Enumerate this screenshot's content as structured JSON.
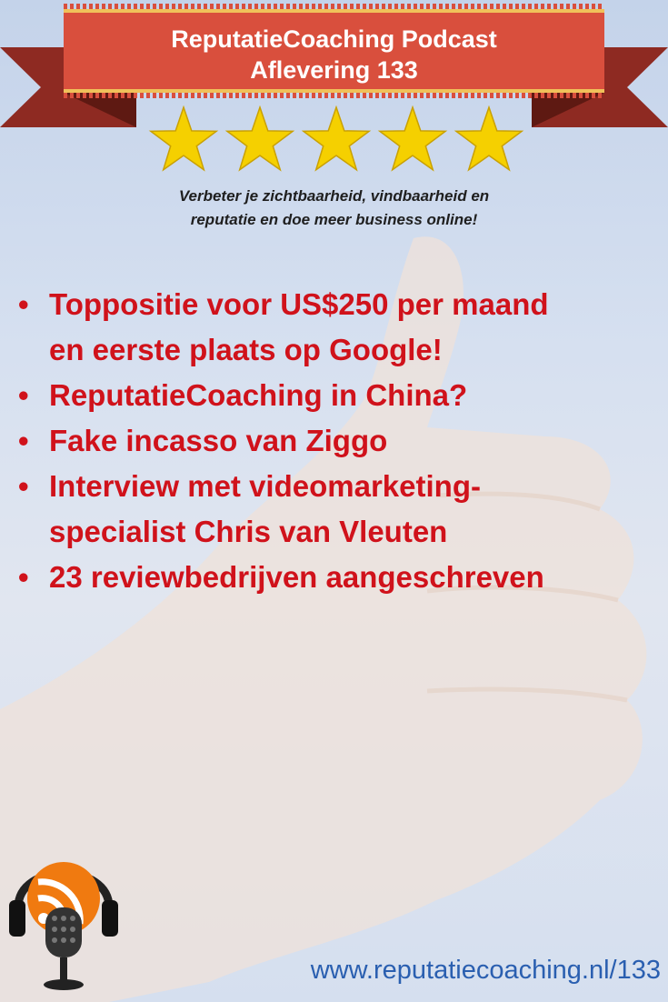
{
  "banner": {
    "title_line1": "ReputatieCoaching Podcast",
    "title_line2": "Aflevering 133"
  },
  "rating": {
    "stars": 5,
    "max": 5
  },
  "tagline": {
    "line1": "Verbeter je zichtbaarheid, vindbaarheid en",
    "line2": "reputatie en doe meer business online!"
  },
  "bullets": [
    {
      "line1": "Toppositie voor US$250 per maand",
      "line2": "en eerste plaats op Google!"
    },
    {
      "line1": "ReputatieCoaching in China?",
      "line2": ""
    },
    {
      "line1": "Fake incasso van Ziggo",
      "line2": ""
    },
    {
      "line1": "Interview met videomarketing-",
      "line2": "specialist Chris van Vleuten"
    },
    {
      "line1": "23 reviewbedrijven aangeschreven",
      "line2": ""
    }
  ],
  "footer": {
    "url": "www.reputatiecoaching.nl/133"
  },
  "colors": {
    "banner": "#d94f3d",
    "bullet_text": "#d0121b",
    "url": "#2a5fb0",
    "star": "#f5d000"
  },
  "icons": [
    "podcast-microphone-icon",
    "rss-feed-icon",
    "headphones-icon",
    "star-icon"
  ]
}
